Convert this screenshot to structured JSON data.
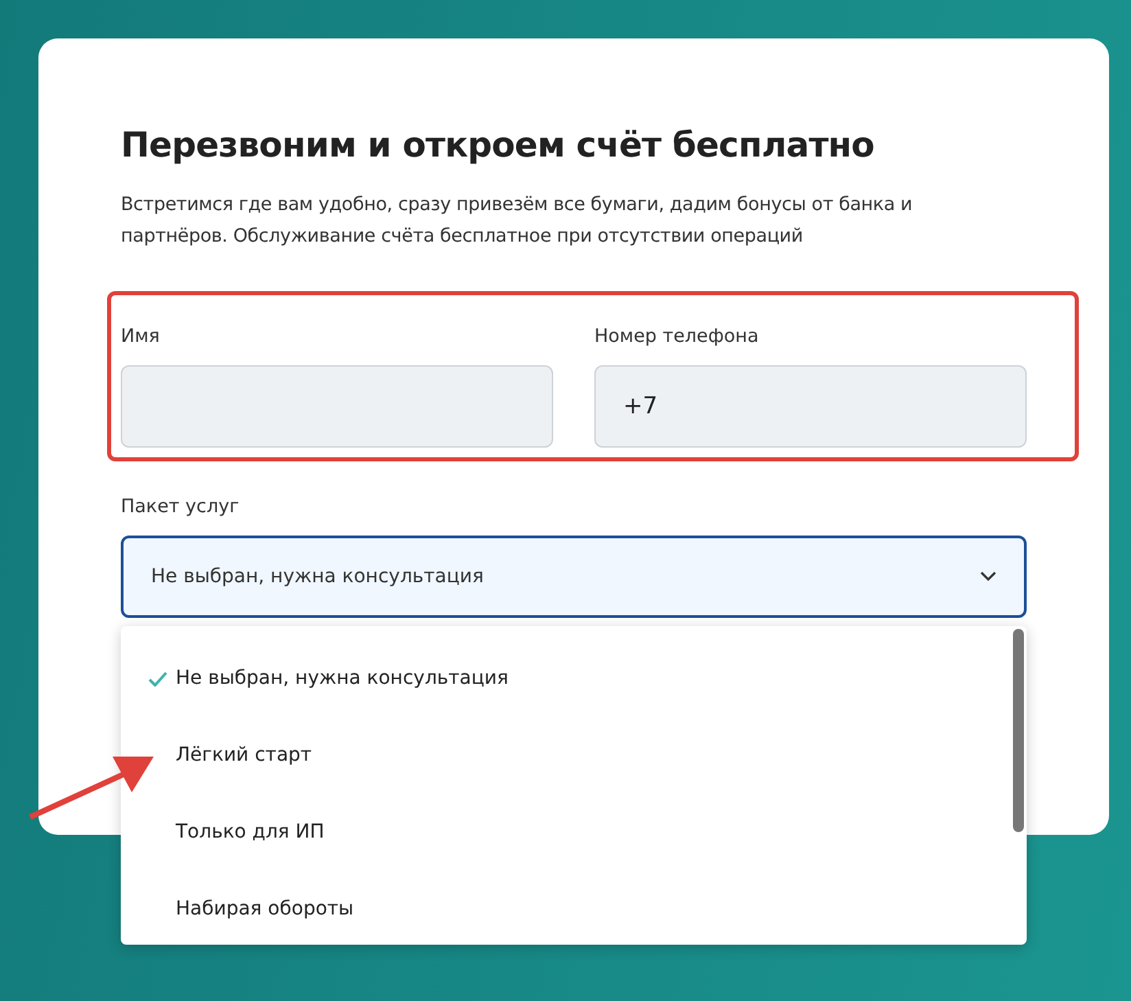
{
  "form": {
    "title": "Перезвоним и откроем счёт бесплатно",
    "description": "Встретимся где вам удобно, сразу привезём все бумаги, дадим бонусы от банка и партнёров. Обслуживание счёта бесплатное при отсутствии операций",
    "fields": [
      {
        "label": "Имя"
      },
      {
        "label": "Номер телефона",
        "value": "+7"
      }
    ],
    "package": {
      "label": "Пакет услуг",
      "value": "Не выбран, нужна консультация",
      "expanded": true,
      "options": [
        {
          "label": "Не выбран, нужна консультация",
          "selected": true
        },
        {
          "label": "Лёгкий старт",
          "selected": false
        },
        {
          "label": "Только для ИП",
          "selected": false
        },
        {
          "label": "Набирая обороты",
          "selected": false
        }
      ]
    }
  }
}
